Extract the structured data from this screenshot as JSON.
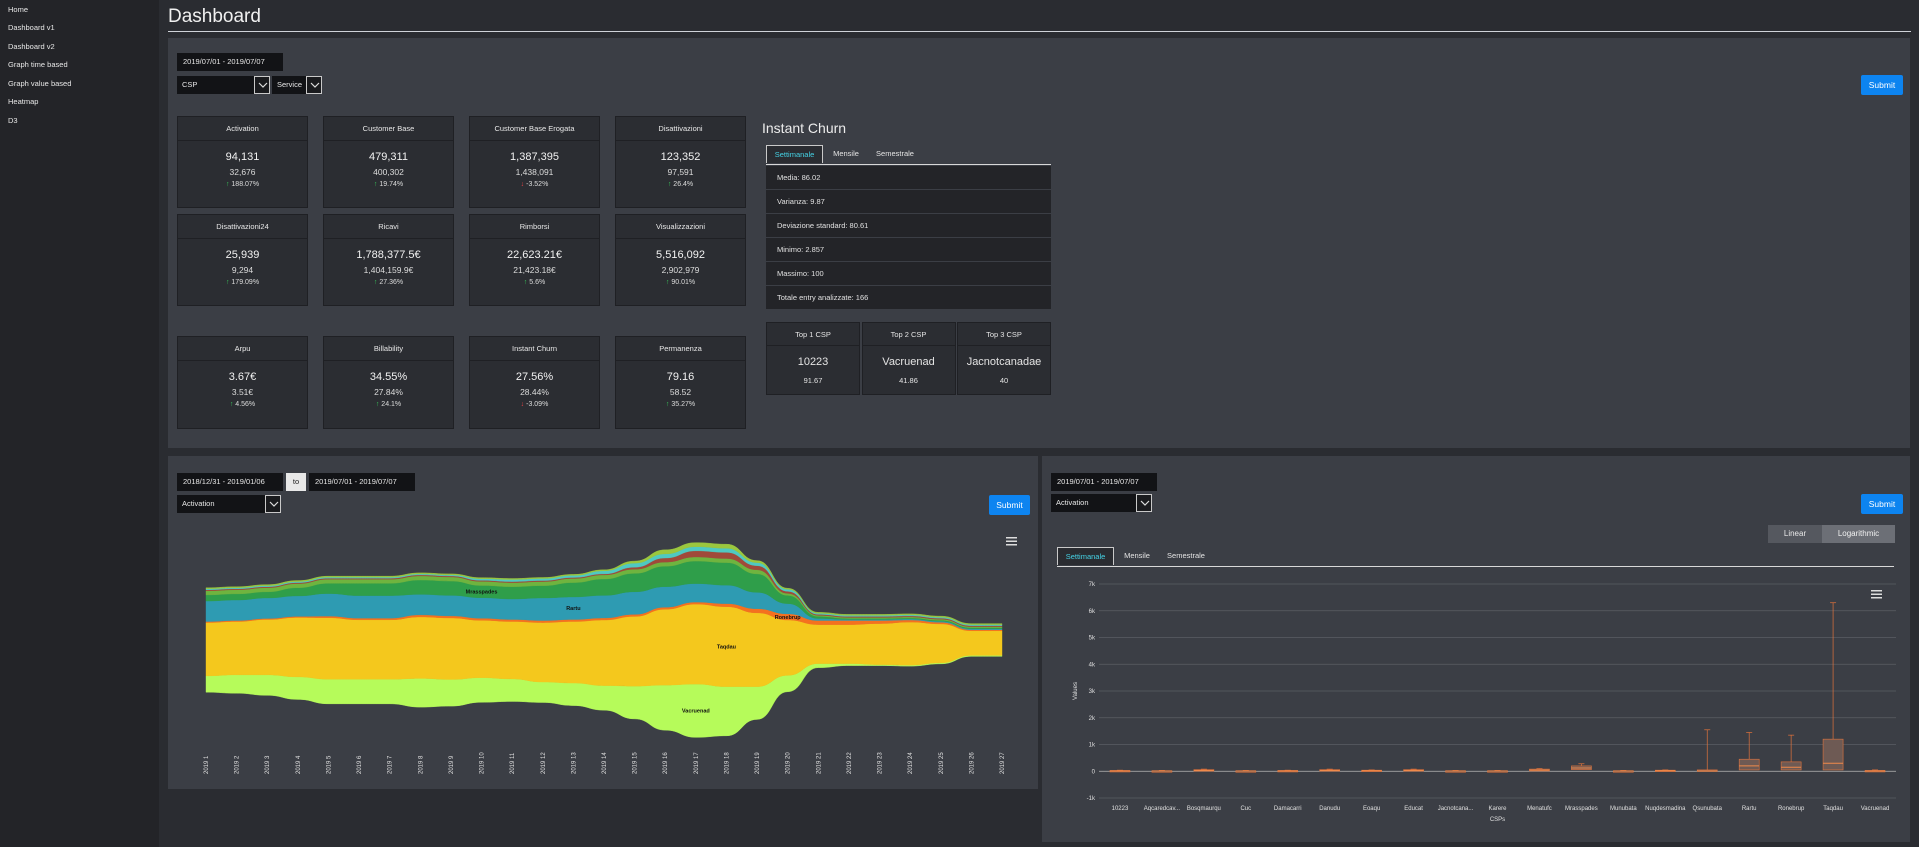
{
  "sidebar": {
    "items": [
      {
        "label": "Home"
      },
      {
        "label": "Dashboard v1"
      },
      {
        "label": "Dashboard v2"
      },
      {
        "label": "Graph time based"
      },
      {
        "label": "Graph value based"
      },
      {
        "label": "Heatmap"
      },
      {
        "label": "D3"
      }
    ]
  },
  "page": {
    "title": "Dashboard"
  },
  "top_panel": {
    "date_range": "2019/07/01 - 2019/07/07",
    "select_1": "CSP",
    "select_2": "Service",
    "submit_label": "Submit"
  },
  "kpis": [
    {
      "title": "Activation",
      "value": "94,131",
      "prev": "32,676",
      "change": "188.07%",
      "trend": "up"
    },
    {
      "title": "Customer Base",
      "value": "479,311",
      "prev": "400,302",
      "change": "19.74%",
      "trend": "up"
    },
    {
      "title": "Customer Base Erogata",
      "value": "1,387,395",
      "prev": "1,438,091",
      "change": "-3.52%",
      "trend": "down"
    },
    {
      "title": "Disattivazioni",
      "value": "123,352",
      "prev": "97,591",
      "change": "26.4%",
      "trend": "up"
    },
    {
      "title": "Disattivazioni24",
      "value": "25,939",
      "prev": "9,294",
      "change": "179.09%",
      "trend": "up"
    },
    {
      "title": "Ricavi",
      "value": "1,788,377.5€",
      "prev": "1,404,159.9€",
      "change": "27.36%",
      "trend": "up"
    },
    {
      "title": "Rimborsi",
      "value": "22,623.21€",
      "prev": "21,423.18€",
      "change": "5.6%",
      "trend": "up"
    },
    {
      "title": "Visualizzazioni",
      "value": "5,516,092",
      "prev": "2,902,979",
      "change": "90.01%",
      "trend": "up"
    },
    {
      "title": "Arpu",
      "value": "3.67€",
      "prev": "3.51€",
      "change": "4.56%",
      "trend": "up"
    },
    {
      "title": "Billability",
      "value": "34.55%",
      "prev": "27.84%",
      "change": "24.1%",
      "trend": "up"
    },
    {
      "title": "Instant Churn",
      "value": "27.56%",
      "prev": "28.44%",
      "change": "-3.09%",
      "trend": "down"
    },
    {
      "title": "Permanenza",
      "value": "79.16",
      "prev": "58.52",
      "change": "35.27%",
      "trend": "up"
    }
  ],
  "churn": {
    "title": "Instant Churn",
    "tabs": [
      "Settimanale",
      "Mensile",
      "Semestrale"
    ],
    "stats": [
      "Media: 86.02",
      "Varianza: 9.87",
      "Deviazione standard: 80.61",
      "Minimo: 2.857",
      "Massimo: 100",
      "Totale entry analizzate: 166"
    ],
    "top": [
      {
        "title": "Top 1 CSP",
        "name": "10223",
        "value": "91.67"
      },
      {
        "title": "Top 2 CSP",
        "name": "Vacruenad",
        "value": "41.86"
      },
      {
        "title": "Top 3 CSP",
        "name": "Jacnotcanadae",
        "value": "40"
      }
    ]
  },
  "stream_panel": {
    "from_range": "2018/12/31 - 2019/01/06",
    "to_label": "to",
    "to_range": "2019/07/01 - 2019/07/07",
    "select": "Activation",
    "submit_label": "Submit",
    "labels": [
      "Mrasspades",
      "Rartu",
      "Ronebrup",
      "Taqdau",
      "Vacruenad"
    ],
    "x_ticks": [
      "2019 1",
      "2019 2",
      "2019 3",
      "2019 4",
      "2019 5",
      "2019 6",
      "2019 7",
      "2019 8",
      "2019 9",
      "2019 10",
      "2019 11",
      "2019 12",
      "2019 13",
      "2019 14",
      "2019 15",
      "2019 16",
      "2019 17",
      "2019 18",
      "2019 19",
      "2019 20",
      "2019 21",
      "2019 22",
      "2019 23",
      "2019 24",
      "2019 25",
      "2019 26",
      "2019 27"
    ]
  },
  "box_panel": {
    "date_range": "2019/07/01 - 2019/07/07",
    "select": "Activation",
    "submit_label": "Submit",
    "scale_options": [
      "Linear",
      "Logarithmic"
    ],
    "tabs": [
      "Settimanale",
      "Mensile",
      "Semestrale"
    ]
  },
  "chart_data": [
    {
      "type": "area",
      "x": [
        "2019 1",
        "2019 2",
        "2019 3",
        "2019 4",
        "2019 5",
        "2019 6",
        "2019 7",
        "2019 8",
        "2019 9",
        "2019 10",
        "2019 11",
        "2019 12",
        "2019 13",
        "2019 14",
        "2019 15",
        "2019 16",
        "2019 17",
        "2019 18",
        "2019 19",
        "2019 20",
        "2019 21",
        "2019 22",
        "2019 23",
        "2019 24",
        "2019 25",
        "2019 26",
        "2019 27"
      ],
      "streamgraph": true,
      "series": [
        {
          "name": "Vacruenad",
          "color": "#b6fb5a",
          "values": [
            8,
            9,
            10,
            11,
            12,
            12,
            12,
            14,
            13,
            12,
            11,
            10,
            11,
            12,
            16,
            22,
            26,
            24,
            16,
            8,
            2,
            1,
            0.5,
            0.5,
            0.5,
            0.5,
            0.5
          ]
        },
        {
          "name": "Taqdau",
          "color": "#f4c81d",
          "values": [
            26,
            26,
            27,
            29,
            30,
            29,
            29,
            30,
            30,
            28,
            28,
            29,
            30,
            32,
            34,
            37,
            39,
            39,
            36,
            27,
            19,
            19,
            20,
            21,
            19,
            12,
            12
          ]
        },
        {
          "name": "Ronebrup",
          "color": "#f4711f",
          "values": [
            0.5,
            0.5,
            0.5,
            0.5,
            0.8,
            0.8,
            0.8,
            1,
            1,
            1,
            1,
            1,
            1,
            1,
            1,
            1,
            1,
            1.5,
            2,
            3,
            2,
            2,
            1.5,
            1,
            0.8,
            0.5,
            0.5
          ]
        },
        {
          "name": "Rartu",
          "color": "#2e9bb2",
          "values": [
            10,
            10,
            10,
            10,
            11,
            11,
            11,
            10,
            10,
            10,
            10,
            11,
            11,
            11,
            11,
            10,
            9,
            9,
            8,
            5,
            1,
            0.5,
            0.5,
            0.5,
            0.5,
            0.5,
            0.5
          ]
        },
        {
          "name": "Mrasspades",
          "color": "#2f9e4a",
          "values": [
            3,
            3,
            3,
            4,
            5,
            6,
            6,
            7,
            7,
            6,
            6,
            6,
            7,
            8,
            9,
            10,
            11,
            11,
            9,
            4,
            1,
            0.5,
            0.5,
            0.5,
            0.5,
            0.5,
            0.5
          ]
        },
        {
          "name": "",
          "color": "#6fb43f",
          "values": [
            2,
            2,
            2,
            2,
            2,
            2,
            2,
            2,
            2,
            2,
            2,
            2,
            2,
            2,
            2,
            2,
            2,
            2,
            2,
            1,
            0.5,
            0.5,
            0.5,
            0.5,
            0.5,
            0.5,
            0.5
          ]
        },
        {
          "name": "",
          "color": "#a04a3a",
          "values": [
            0.5,
            0.5,
            0.5,
            0.5,
            0.5,
            0.5,
            0.5,
            0.5,
            0.5,
            0.5,
            0.5,
            0.5,
            0.5,
            0.5,
            1,
            2,
            3,
            3,
            2,
            1,
            0.5,
            0.5,
            0.5,
            0.5,
            0.5,
            0.5,
            0.5
          ]
        },
        {
          "name": "",
          "color": "#4fc9c2",
          "values": [
            0.5,
            0.5,
            0.5,
            0.5,
            0.5,
            0.5,
            0.5,
            0.5,
            0.5,
            0.8,
            1,
            1,
            1,
            1.5,
            2,
            2,
            2,
            2,
            1.5,
            1,
            0.5,
            0.5,
            0.5,
            0.5,
            0.5,
            0.5,
            0.5
          ]
        },
        {
          "name": "",
          "color": "#9bc73e",
          "values": [
            0.5,
            0.5,
            0.5,
            0.5,
            0.5,
            0.5,
            0.5,
            0.5,
            0.5,
            0.5,
            0.5,
            0.5,
            0.5,
            0.5,
            1,
            2,
            2,
            2,
            1,
            0.5,
            0.5,
            0.5,
            0.5,
            0.5,
            0.5,
            0.5,
            0.5
          ]
        }
      ]
    },
    {
      "type": "box",
      "xlabel": "CSPs",
      "ylabel": "Values",
      "ylim": [
        -1000,
        7000
      ],
      "yticks": [
        "-1k",
        "0",
        "1k",
        "2k",
        "3k",
        "4k",
        "5k",
        "6k",
        "7k"
      ],
      "ytick_values": [
        -1000,
        0,
        1000,
        2000,
        3000,
        4000,
        5000,
        6000,
        7000
      ],
      "categories": [
        "10223",
        "Aqcaredcav...",
        "Bosqmaurqu",
        "Cuc",
        "Damacarri",
        "Danudu",
        "Eoaqu",
        "Educat",
        "Jacnotcana...",
        "Karere",
        "Menatufc",
        "Mrasspades",
        "Munubata",
        "Nuqdesmadina",
        "Qsunubata",
        "Rartu",
        "Ronebrup",
        "Taqdau",
        "Vacruenad"
      ],
      "boxes": [
        {
          "min": 0,
          "q1": 0,
          "median": 10,
          "q3": 30,
          "max": 40
        },
        {
          "min": 0,
          "q1": 0,
          "median": 10,
          "q3": 20,
          "max": 30
        },
        {
          "min": 0,
          "q1": 10,
          "median": 30,
          "q3": 60,
          "max": 80
        },
        {
          "min": 0,
          "q1": 0,
          "median": 10,
          "q3": 20,
          "max": 30
        },
        {
          "min": 0,
          "q1": 0,
          "median": 10,
          "q3": 30,
          "max": 40
        },
        {
          "min": 0,
          "q1": 10,
          "median": 30,
          "q3": 60,
          "max": 80
        },
        {
          "min": 0,
          "q1": 0,
          "median": 20,
          "q3": 40,
          "max": 50
        },
        {
          "min": 0,
          "q1": 10,
          "median": 30,
          "q3": 60,
          "max": 80
        },
        {
          "min": 0,
          "q1": 0,
          "median": 10,
          "q3": 20,
          "max": 30
        },
        {
          "min": 0,
          "q1": 0,
          "median": 10,
          "q3": 20,
          "max": 30
        },
        {
          "min": 0,
          "q1": 10,
          "median": 40,
          "q3": 80,
          "max": 100
        },
        {
          "min": 0,
          "q1": 60,
          "median": 120,
          "q3": 200,
          "max": 280
        },
        {
          "min": 0,
          "q1": 0,
          "median": 10,
          "q3": 20,
          "max": 30
        },
        {
          "min": 0,
          "q1": 0,
          "median": 20,
          "q3": 40,
          "max": 50
        },
        {
          "min": 0,
          "q1": 0,
          "median": 10,
          "q3": 50,
          "max": 1550
        },
        {
          "min": 0,
          "q1": 50,
          "median": 200,
          "q3": 450,
          "max": 1450
        },
        {
          "min": 0,
          "q1": 50,
          "median": 150,
          "q3": 350,
          "max": 1350
        },
        {
          "min": 0,
          "q1": 50,
          "median": 300,
          "q3": 1200,
          "max": 6300
        },
        {
          "min": 0,
          "q1": 0,
          "median": 10,
          "q3": 30,
          "max": 50
        }
      ]
    }
  ]
}
